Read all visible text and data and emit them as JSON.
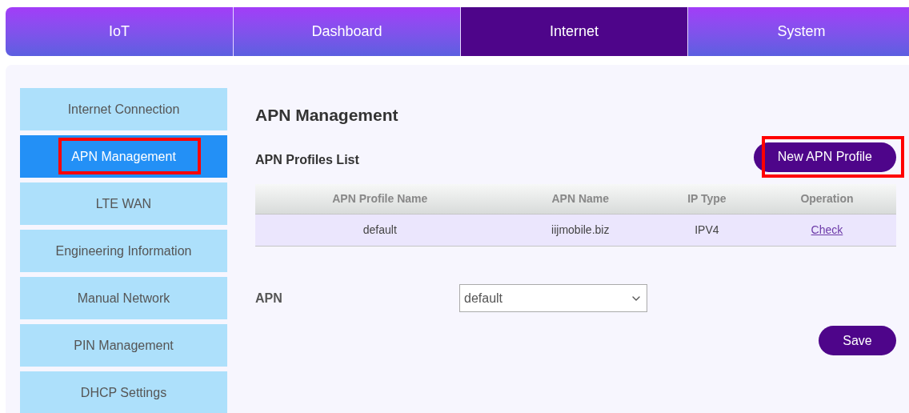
{
  "tabs": [
    {
      "label": "IoT",
      "selected": false
    },
    {
      "label": "Dashboard",
      "selected": false
    },
    {
      "label": "Internet",
      "selected": true
    },
    {
      "label": "System",
      "selected": false
    }
  ],
  "sidebar": {
    "items": [
      {
        "label": "Internet Connection",
        "selected": false,
        "highlighted": false
      },
      {
        "label": "APN Management",
        "selected": true,
        "highlighted": true
      },
      {
        "label": "LTE WAN",
        "selected": false,
        "highlighted": false
      },
      {
        "label": "Engineering Information",
        "selected": false,
        "highlighted": false
      },
      {
        "label": "Manual Network",
        "selected": false,
        "highlighted": false
      },
      {
        "label": "PIN Management",
        "selected": false,
        "highlighted": false
      },
      {
        "label": "DHCP Settings",
        "selected": false,
        "highlighted": false
      }
    ]
  },
  "page_title": "APN Management",
  "profiles": {
    "title": "APN Profiles List",
    "new_button": {
      "label": "New APN Profile",
      "highlighted": true
    },
    "columns": [
      "APN Profile Name",
      "APN Name",
      "IP Type",
      "Operation"
    ],
    "rows": [
      {
        "profile": "default",
        "apn": "iijmobile.biz",
        "ip_type": "IPV4",
        "operation": "Check"
      }
    ]
  },
  "apn_field": {
    "label": "APN",
    "value": "default"
  },
  "save_button": "Save"
}
